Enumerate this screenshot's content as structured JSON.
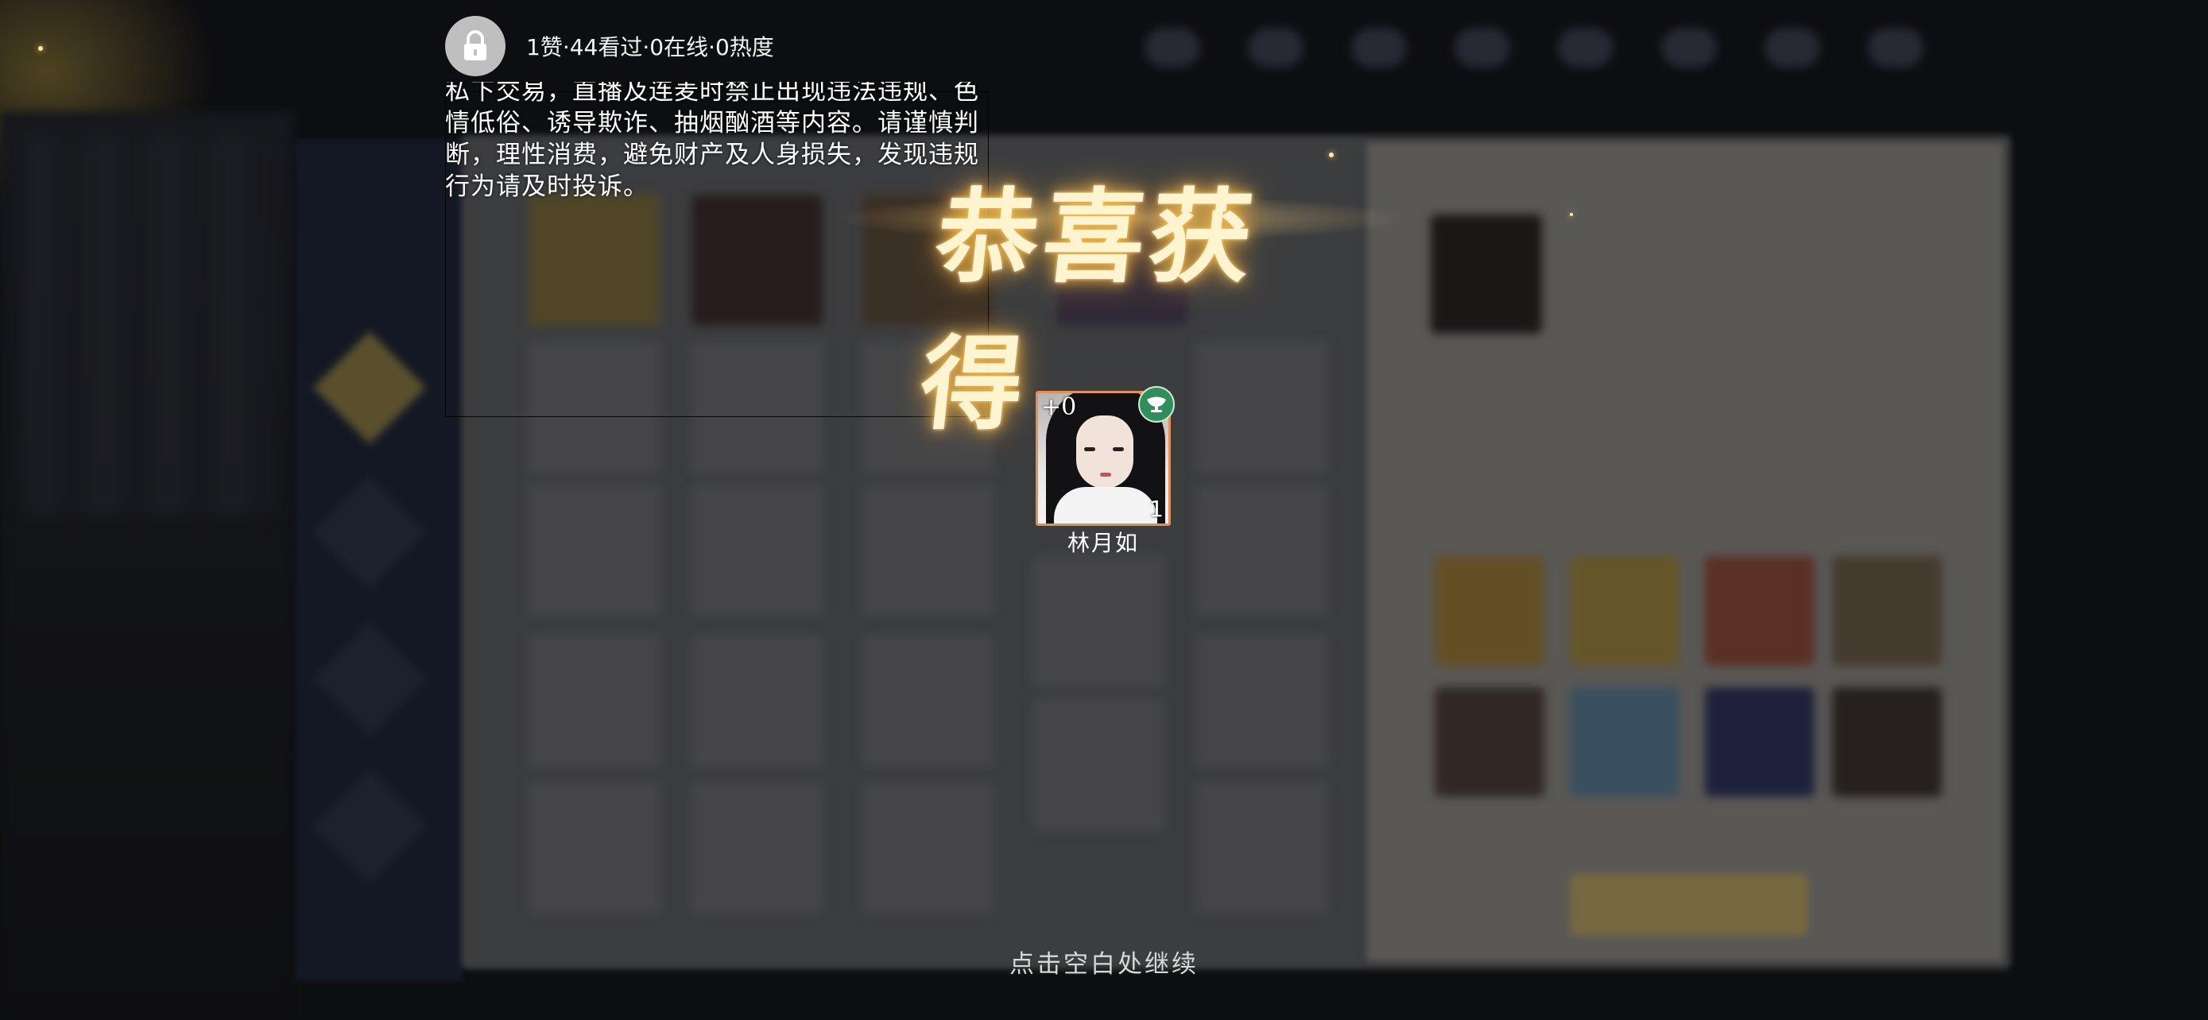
{
  "header": {
    "stats": "1赞·44看过·0在线·0热度",
    "lock_icon": "lock-icon"
  },
  "notice": {
    "text": "私下交易，直播及连麦时禁止出现违法违规、色情低俗、诱导欺诈、抽烟酗酒等内容。请谨慎判断，理性消费，避免财产及人身损失，发现违规行为请及时投诉。"
  },
  "reward_popup": {
    "title": "恭喜获得",
    "item": {
      "name": "林月如",
      "plus": "+0",
      "count": "1",
      "badge_icon": "jade-cup-icon"
    },
    "continue_hint": "点击空白处继续"
  },
  "colors": {
    "item_border": "#e0905a",
    "badge": "#2f8e5a",
    "title_glow": "#f0b84a"
  }
}
